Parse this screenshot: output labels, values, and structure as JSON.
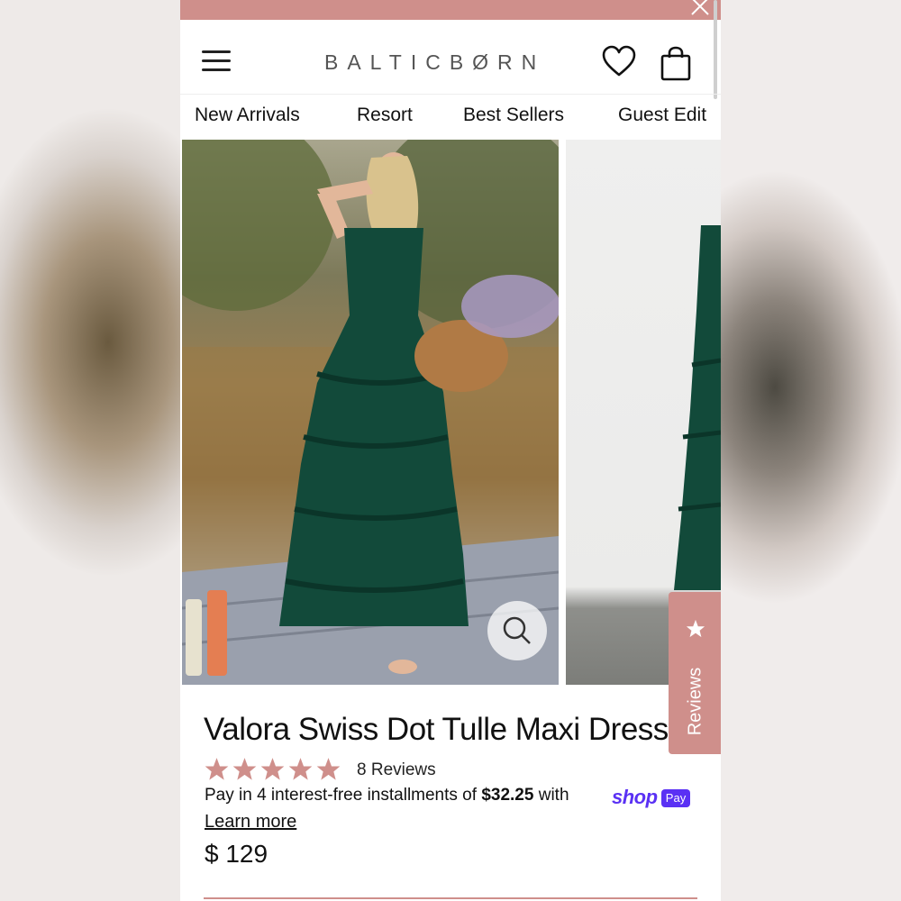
{
  "brand": {
    "logo_text": "BALTICBØRN"
  },
  "header": {
    "menu_icon": "hamburger-menu-icon",
    "wishlist_icon": "heart-icon",
    "cart_icon": "shopping-bag-icon",
    "close_icon": "close-icon"
  },
  "nav": {
    "items": [
      {
        "label": "New Arrivals"
      },
      {
        "label": "Resort"
      },
      {
        "label": "Best Sellers"
      },
      {
        "label": "Guest Edit"
      }
    ]
  },
  "gallery": {
    "zoom_icon": "magnifier-icon"
  },
  "reviews_tab": {
    "label": "Reviews",
    "icon": "star-icon"
  },
  "product": {
    "title": "Valora Swiss Dot Tulle Maxi Dress",
    "rating": 5,
    "rating_max": 5,
    "review_count": "8 Reviews",
    "installments_prefix": "Pay in 4 interest-free installments of ",
    "installment_amount": "$32.25",
    "installments_suffix": " with",
    "shop_pay_logo": "shop",
    "shop_pay_badge": "Pay",
    "learn_more": "Learn more",
    "price": "$ 129"
  },
  "colors": {
    "accent": "#cf8f8b",
    "shop_pay": "#5a31f4",
    "text": "#111111"
  }
}
